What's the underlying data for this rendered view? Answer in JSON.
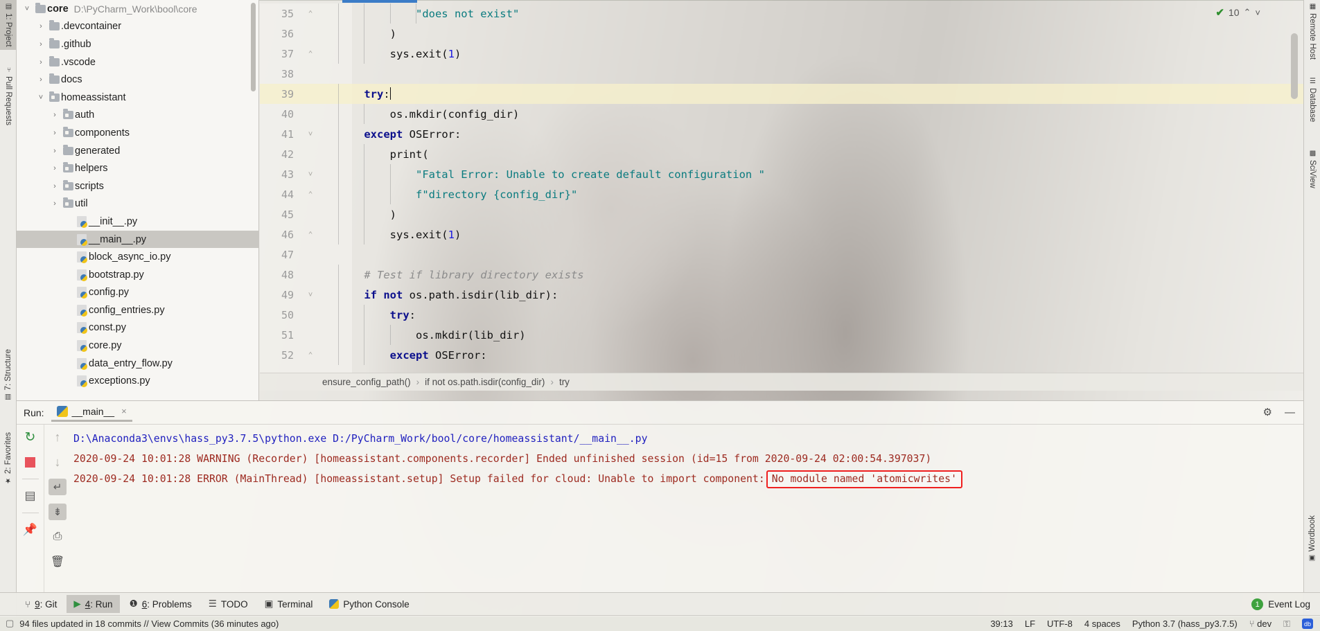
{
  "left_stripe": [
    {
      "label": "1: Project",
      "active": true,
      "icon": "project-icon"
    },
    {
      "label": "Pull Requests",
      "active": false,
      "icon": "pull-request-icon"
    },
    {
      "label": "7: Structure",
      "active": false,
      "icon": "structure-icon"
    },
    {
      "label": "2: Favorites",
      "active": false,
      "icon": "star-icon"
    }
  ],
  "right_stripe": [
    {
      "label": "Remote Host",
      "icon": "remote-host-icon"
    },
    {
      "label": "Database",
      "icon": "database-icon"
    },
    {
      "label": "SciView",
      "icon": "sciview-icon"
    },
    {
      "label": "Wordbook",
      "icon": "wordbook-icon"
    }
  ],
  "project_tree": [
    {
      "name": "core",
      "path": "D:\\PyCharm_Work\\bool\\core",
      "depth": 0,
      "chevron": "˅",
      "icon": "folder-icon",
      "bold": true,
      "selected": false
    },
    {
      "name": ".devcontainer",
      "path": "",
      "depth": 1,
      "chevron": "›",
      "icon": "folder-icon",
      "bold": false,
      "selected": false
    },
    {
      "name": ".github",
      "path": "",
      "depth": 1,
      "chevron": "›",
      "icon": "folder-icon",
      "bold": false,
      "selected": false
    },
    {
      "name": ".vscode",
      "path": "",
      "depth": 1,
      "chevron": "›",
      "icon": "folder-icon",
      "bold": false,
      "selected": false
    },
    {
      "name": "docs",
      "path": "",
      "depth": 1,
      "chevron": "›",
      "icon": "folder-icon",
      "bold": false,
      "selected": false
    },
    {
      "name": "homeassistant",
      "path": "",
      "depth": 1,
      "chevron": "˅",
      "icon": "source-folder-icon",
      "bold": false,
      "selected": false
    },
    {
      "name": "auth",
      "path": "",
      "depth": 2,
      "chevron": "›",
      "icon": "source-folder-icon",
      "bold": false,
      "selected": false
    },
    {
      "name": "components",
      "path": "",
      "depth": 2,
      "chevron": "›",
      "icon": "source-folder-icon",
      "bold": false,
      "selected": false
    },
    {
      "name": "generated",
      "path": "",
      "depth": 2,
      "chevron": "›",
      "icon": "folder-icon",
      "bold": false,
      "selected": false
    },
    {
      "name": "helpers",
      "path": "",
      "depth": 2,
      "chevron": "›",
      "icon": "source-folder-icon",
      "bold": false,
      "selected": false
    },
    {
      "name": "scripts",
      "path": "",
      "depth": 2,
      "chevron": "›",
      "icon": "source-folder-icon",
      "bold": false,
      "selected": false
    },
    {
      "name": "util",
      "path": "",
      "depth": 2,
      "chevron": "›",
      "icon": "source-folder-icon",
      "bold": false,
      "selected": false
    },
    {
      "name": "__init__.py",
      "path": "",
      "depth": 3,
      "chevron": "",
      "icon": "python-file-icon",
      "bold": false,
      "selected": false
    },
    {
      "name": "__main__.py",
      "path": "",
      "depth": 3,
      "chevron": "",
      "icon": "python-file-icon",
      "bold": false,
      "selected": true
    },
    {
      "name": "block_async_io.py",
      "path": "",
      "depth": 3,
      "chevron": "",
      "icon": "python-file-icon",
      "bold": false,
      "selected": false
    },
    {
      "name": "bootstrap.py",
      "path": "",
      "depth": 3,
      "chevron": "",
      "icon": "python-file-icon",
      "bold": false,
      "selected": false
    },
    {
      "name": "config.py",
      "path": "",
      "depth": 3,
      "chevron": "",
      "icon": "python-file-icon",
      "bold": false,
      "selected": false
    },
    {
      "name": "config_entries.py",
      "path": "",
      "depth": 3,
      "chevron": "",
      "icon": "python-file-icon",
      "bold": false,
      "selected": false
    },
    {
      "name": "const.py",
      "path": "",
      "depth": 3,
      "chevron": "",
      "icon": "python-file-icon",
      "bold": false,
      "selected": false
    },
    {
      "name": "core.py",
      "path": "",
      "depth": 3,
      "chevron": "",
      "icon": "python-file-icon",
      "bold": false,
      "selected": false
    },
    {
      "name": "data_entry_flow.py",
      "path": "",
      "depth": 3,
      "chevron": "",
      "icon": "python-file-icon",
      "bold": false,
      "selected": false
    },
    {
      "name": "exceptions.py",
      "path": "",
      "depth": 3,
      "chevron": "",
      "icon": "python-file-icon",
      "bold": false,
      "selected": false
    }
  ],
  "editor": {
    "inspection_count": "10",
    "up_arrow": "⌃",
    "down_arrow": "˅",
    "current_line": 39,
    "lines": [
      {
        "n": 35,
        "fold": "⌃",
        "indent": 16,
        "tokens": [
          {
            "t": "            ",
            "c": "plain"
          },
          {
            "t": "\"does not exist\"",
            "c": "str"
          }
        ]
      },
      {
        "n": 36,
        "fold": "",
        "indent": 8,
        "tokens": [
          {
            "t": "        )",
            "c": "id"
          }
        ]
      },
      {
        "n": 37,
        "fold": "⌃",
        "indent": 8,
        "tokens": [
          {
            "t": "        sys.exit(",
            "c": "id"
          },
          {
            "t": "1",
            "c": "num"
          },
          {
            "t": ")",
            "c": "id"
          }
        ]
      },
      {
        "n": 38,
        "fold": "",
        "indent": 0,
        "tokens": [
          {
            "t": "",
            "c": "plain"
          }
        ]
      },
      {
        "n": 39,
        "fold": "",
        "indent": 4,
        "tokens": [
          {
            "t": "    ",
            "c": "plain"
          },
          {
            "t": "try",
            "c": "kw"
          },
          {
            "t": ":",
            "c": "id"
          }
        ],
        "caret": true
      },
      {
        "n": 40,
        "fold": "",
        "indent": 8,
        "tokens": [
          {
            "t": "        os.mkdir(config_dir)",
            "c": "id"
          }
        ]
      },
      {
        "n": 41,
        "fold": "˅",
        "indent": 4,
        "tokens": [
          {
            "t": "    ",
            "c": "plain"
          },
          {
            "t": "except",
            "c": "kw"
          },
          {
            "t": " OSError:",
            "c": "id"
          }
        ]
      },
      {
        "n": 42,
        "fold": "",
        "indent": 8,
        "tokens": [
          {
            "t": "        print(",
            "c": "id"
          }
        ]
      },
      {
        "n": 43,
        "fold": "˅",
        "indent": 12,
        "tokens": [
          {
            "t": "            ",
            "c": "plain"
          },
          {
            "t": "\"Fatal Error: Unable to create default configuration \"",
            "c": "str"
          }
        ]
      },
      {
        "n": 44,
        "fold": "⌃",
        "indent": 12,
        "tokens": [
          {
            "t": "            ",
            "c": "plain"
          },
          {
            "t": "f\"directory {config_dir}\"",
            "c": "str"
          }
        ]
      },
      {
        "n": 45,
        "fold": "",
        "indent": 8,
        "tokens": [
          {
            "t": "        )",
            "c": "id"
          }
        ]
      },
      {
        "n": 46,
        "fold": "⌃",
        "indent": 8,
        "tokens": [
          {
            "t": "        sys.exit(",
            "c": "id"
          },
          {
            "t": "1",
            "c": "num"
          },
          {
            "t": ")",
            "c": "id"
          }
        ]
      },
      {
        "n": 47,
        "fold": "",
        "indent": 0,
        "tokens": [
          {
            "t": "",
            "c": "plain"
          }
        ]
      },
      {
        "n": 48,
        "fold": "",
        "indent": 4,
        "tokens": [
          {
            "t": "    ",
            "c": "plain"
          },
          {
            "t": "# Test if library directory exists",
            "c": "com"
          }
        ]
      },
      {
        "n": 49,
        "fold": "˅",
        "indent": 4,
        "tokens": [
          {
            "t": "    ",
            "c": "plain"
          },
          {
            "t": "if not",
            "c": "kw"
          },
          {
            "t": " os.path.isdir(lib_dir):",
            "c": "id"
          }
        ]
      },
      {
        "n": 50,
        "fold": "",
        "indent": 8,
        "tokens": [
          {
            "t": "        ",
            "c": "plain"
          },
          {
            "t": "try",
            "c": "kw"
          },
          {
            "t": ":",
            "c": "id"
          }
        ]
      },
      {
        "n": 51,
        "fold": "",
        "indent": 12,
        "tokens": [
          {
            "t": "            os.mkdir(lib_dir)",
            "c": "id"
          }
        ]
      },
      {
        "n": 52,
        "fold": "⌃",
        "indent": 8,
        "tokens": [
          {
            "t": "        ",
            "c": "plain"
          },
          {
            "t": "except",
            "c": "kw"
          },
          {
            "t": " OSError:",
            "c": "id"
          }
        ]
      }
    ]
  },
  "breadcrumb": {
    "items": [
      "ensure_config_path()",
      "if not os.path.isdir(config_dir)",
      "try"
    ],
    "separator": "›"
  },
  "run_window": {
    "label": "Run:",
    "tab_name": "__main__",
    "tab_close": "×",
    "settings_icon": "gear-icon",
    "minimize_icon": "minimize-icon",
    "toolbar": [
      {
        "name": "rerun-button",
        "glyph": "↻"
      },
      {
        "name": "stop-button",
        "glyph": "■"
      },
      {
        "name": "restore-layout-button",
        "glyph": "▤"
      },
      {
        "name": "pin-tab-button",
        "glyph": "✒"
      },
      {
        "name": "up-stack-trace-button",
        "glyph": "↑"
      },
      {
        "name": "down-stack-trace-button",
        "glyph": "↓"
      },
      {
        "name": "soft-wrap-button",
        "glyph": "↵"
      },
      {
        "name": "scroll-to-end-button",
        "glyph": "⤓"
      },
      {
        "name": "print-button",
        "glyph": "⎙"
      },
      {
        "name": "clear-all-button",
        "glyph": "Ὕ1"
      }
    ],
    "console_lines": [
      {
        "color": "blue",
        "segments": [
          {
            "text": "D:\\Anaconda3\\envs\\hass_py3.7.5\\python.exe D:/PyCharm_Work/bool/core/homeassistant/__main__.py",
            "boxed": false
          }
        ]
      },
      {
        "color": "red",
        "segments": [
          {
            "text": "2020-09-24 10:01:28 WARNING (Recorder) [homeassistant.components.recorder] Ended unfinished session (id=15 from 2020-09-24 02:00:54.397037)",
            "boxed": false
          }
        ]
      },
      {
        "color": "red",
        "segments": [
          {
            "text": "2020-09-24 10:01:28 ERROR (MainThread) [homeassistant.setup] Setup failed for cloud: Unable to import component:",
            "boxed": false
          },
          {
            "text": "No module named 'atomicwrites'",
            "boxed": true
          }
        ]
      }
    ]
  },
  "bottom_bar": {
    "items": [
      {
        "num": "9",
        "label": ": Git",
        "icon": "git-branch-icon",
        "active": false
      },
      {
        "num": "4",
        "label": ": Run",
        "icon": "run-icon",
        "active": true
      },
      {
        "num": "6",
        "label": ": Problems",
        "icon": "problems-icon",
        "active": false
      },
      {
        "num": "",
        "label": "TODO",
        "icon": "todo-icon",
        "active": false
      },
      {
        "num": "",
        "label": "Terminal",
        "icon": "terminal-icon",
        "active": false
      },
      {
        "num": "",
        "label": "Python Console",
        "icon": "python-console-icon",
        "active": false
      }
    ],
    "event_log": {
      "badge": "1",
      "label": "Event Log"
    }
  },
  "status_bar": {
    "message": "94 files updated in 18 commits // View Commits (36 minutes ago)",
    "caret_position": "39:13",
    "line_separator": "LF",
    "encoding": "UTF-8",
    "indent": "4 spaces",
    "interpreter": "Python 3.7 (hass_py3.7.5)",
    "branch": "dev",
    "branch_icon": "git-branch-icon",
    "lock_icon": "lock-icon",
    "baidu_icon": "baidu-icon",
    "baidu_text": "db"
  },
  "colors": {
    "accent_blue": "#3b7cc7",
    "error_red": "#ef1f1f",
    "console_red": "#9d2a20",
    "console_blue": "#1f1fbe",
    "string_green": "#0a7b7f",
    "keyword_blue": "#0b0f8c",
    "highlight_line": "#f6f0cc",
    "selection_gray": "#c9c7c2"
  }
}
